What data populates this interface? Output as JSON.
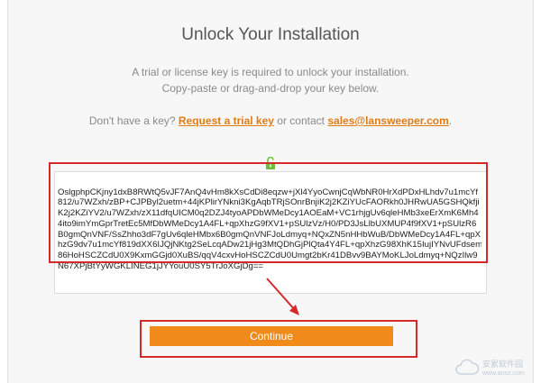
{
  "dialog": {
    "title": "Unlock Your Installation",
    "subtitle_line1": "A trial or license key is required to unlock your installation.",
    "subtitle_line2": "Copy-paste or drag-and-drop your key below.",
    "contact_prefix": "Don't have a key?",
    "trial_link": "Request a trial key",
    "contact_middle": "or contact",
    "email_link": "sales@lansweeper.com",
    "contact_suffix": "."
  },
  "key_field": {
    "lines": [
      "OslgphpCKjny1dxB8RWtQ5vJF7AnQ4vHm8kXsCdDi8eqzw+jXl4YyoCwnjCqWbNR0HrXdPDxHLhdv7u1mcYf",
      "812/u7WZxh/zBP+CJPByl2uetm+44jKPlirYNkni3KgAqbTRjSOnrBnjiK2j2KZiYUcFAORkh0JHRwUA5GSHQkfji",
      "K2j2KZiYV2/u7WZxh/zX11dfqUICM0q2DZJ4tyoAPDbWMeDcy1AOEaM+VC1rhjgUv6qleHMb3xeErXmK6Mh4",
      "4ito9imYmGprTretEc5MfDbWMeDcy1A4FL+qpXhzG9fXV1+pSUlzVz/H0/PD3JsLlbUXMUP4f9fXV1+pSUlzR6",
      "B0gmQnVNF/SsZhho3dF7gUv6qleHMbx6B0gmQnVNFJoLdmyq+NQxZN5nHHbWuB/DbWMeDcy1A4FL+qpX",
      "hzG9dv7u1mcYf819dXX6IJQjNKtg2SeLcqADw21jHg3MtQDhGjPlQta4Y4FL+qpXhzG98XhK15IujIYNvUFdsem",
      "86HoHSCZCdU0X9KxmGGjd0XuBS/qqV4cxvHoHSCZCdU0Umgt2bKr41DBvv9BAYMoKLJoLdmyq+NQzIlw9",
      "N67XPjBtYyWGKLINEG1jJYYouU0SY5TrJoXGjDg=="
    ]
  },
  "continue_button": {
    "label": "Continue"
  },
  "watermark": {
    "line1": "安累软件园",
    "line2": "www.anxz.com"
  }
}
